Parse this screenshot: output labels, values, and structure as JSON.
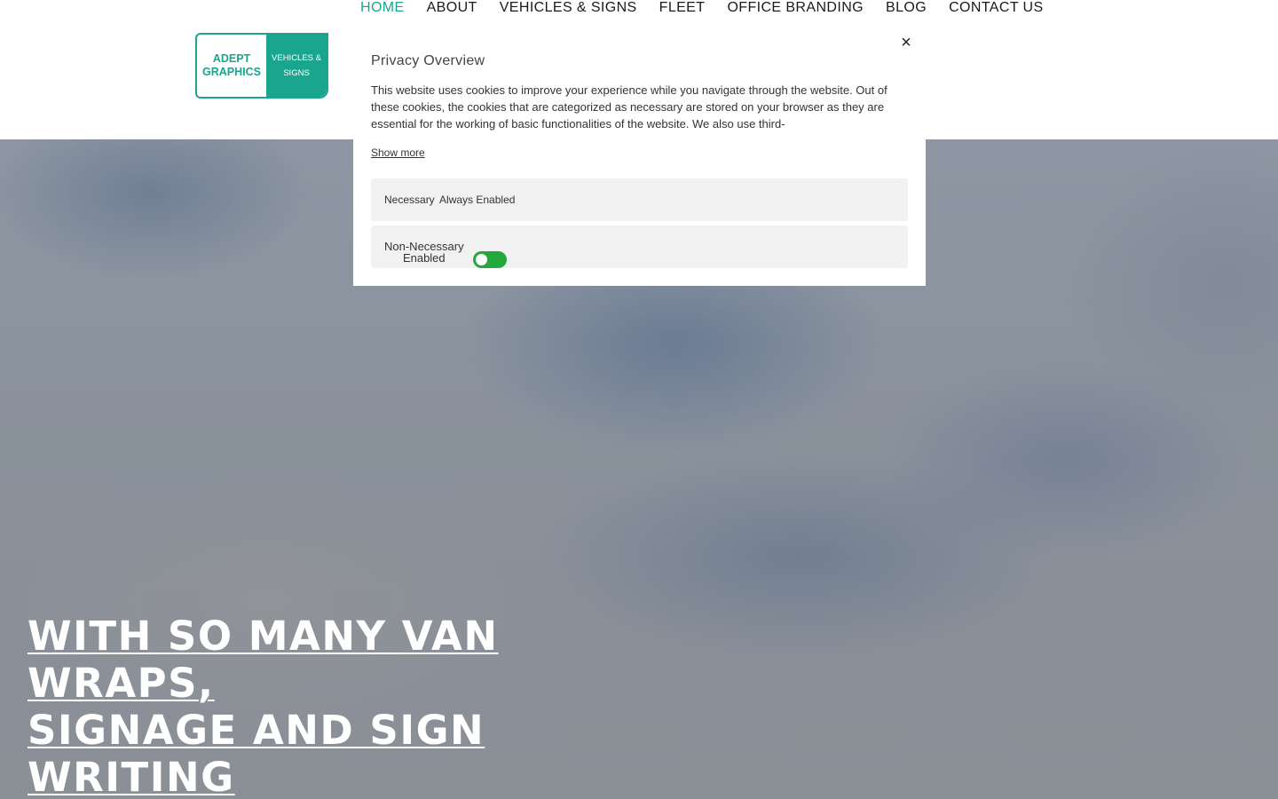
{
  "nav": {
    "items": [
      {
        "label": "HOME",
        "active": true
      },
      {
        "label": "ABOUT",
        "active": false
      },
      {
        "label": "VEHICLES & SIGNS",
        "active": false
      },
      {
        "label": "FLEET",
        "active": false
      },
      {
        "label": "OFFICE BRANDING",
        "active": false
      },
      {
        "label": "BLOG",
        "active": false
      },
      {
        "label": "CONTACT US",
        "active": false
      }
    ],
    "active_color": "#1aa68e"
  },
  "logo": {
    "line1": "ADEPT",
    "line2": "GRAPHICS",
    "tag1": "VEHICLES &",
    "tag2": "SIGNS",
    "brand_color": "#1aa68e"
  },
  "privacy_modal": {
    "title": "Privacy Overview",
    "body": "This website uses cookies to improve your experience while you navigate through the website. Out of these cookies, the cookies that are categorized as necessary are stored on your browser as they are essential for the working of basic functionalities of the website. We also use third-",
    "show_more": "Show more",
    "close_icon": "×",
    "categories": {
      "necessary": {
        "label": "Necessary",
        "status": "Always Enabled"
      },
      "non_necessary": {
        "label": "Non-Necessary",
        "status": "Enabled",
        "enabled": true,
        "toggle_color": "#22a83b"
      }
    }
  },
  "hero": {
    "lines": [
      "WITH SO MANY VAN",
      "WRAPS,",
      "SIGNAGE AND SIGN",
      "WRITING"
    ]
  }
}
